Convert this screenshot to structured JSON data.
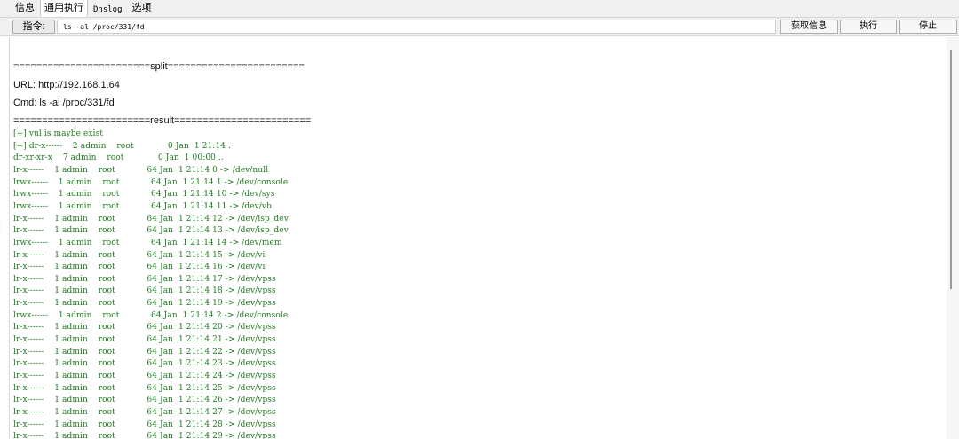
{
  "tabs": [
    {
      "label": "信息"
    },
    {
      "label": "通用执行"
    },
    {
      "label": "Dnslog"
    },
    {
      "label": "选项"
    }
  ],
  "toolbar": {
    "cmd_label": "指令:",
    "cmd_value": "ls -al /proc/331/fd",
    "btn_info": "获取信息",
    "btn_exec": "执行",
    "btn_stop": "停止"
  },
  "output": {
    "split_line": "========================split========================",
    "url": "URL: http://192.168.1.64",
    "cmd": "Cmd: ls -al /proc/331/fd",
    "result_line": "========================result========================",
    "lines": [
      "[+] vul is maybe exist",
      "[+] dr-x------    2 admin    root             0 Jan  1 21:14 .",
      "dr-xr-xr-x    7 admin    root             0 Jan  1 00:00 ..",
      "lr-x------    1 admin    root            64 Jan  1 21:14 0 -> /dev/null",
      "lrwx------    1 admin    root            64 Jan  1 21:14 1 -> /dev/console",
      "lrwx------    1 admin    root            64 Jan  1 21:14 10 -> /dev/sys",
      "lrwx------    1 admin    root            64 Jan  1 21:14 11 -> /dev/vb",
      "lr-x------    1 admin    root            64 Jan  1 21:14 12 -> /dev/isp_dev",
      "lr-x------    1 admin    root            64 Jan  1 21:14 13 -> /dev/isp_dev",
      "lrwx------    1 admin    root            64 Jan  1 21:14 14 -> /dev/mem",
      "lr-x------    1 admin    root            64 Jan  1 21:14 15 -> /dev/vi",
      "lr-x------    1 admin    root            64 Jan  1 21:14 16 -> /dev/vi",
      "lr-x------    1 admin    root            64 Jan  1 21:14 17 -> /dev/vpss",
      "lr-x------    1 admin    root            64 Jan  1 21:14 18 -> /dev/vpss",
      "lr-x------    1 admin    root            64 Jan  1 21:14 19 -> /dev/vpss",
      "lrwx------    1 admin    root            64 Jan  1 21:14 2 -> /dev/console",
      "lr-x------    1 admin    root            64 Jan  1 21:14 20 -> /dev/vpss",
      "lr-x------    1 admin    root            64 Jan  1 21:14 21 -> /dev/vpss",
      "lr-x------    1 admin    root            64 Jan  1 21:14 22 -> /dev/vpss",
      "lr-x------    1 admin    root            64 Jan  1 21:14 23 -> /dev/vpss",
      "lr-x------    1 admin    root            64 Jan  1 21:14 24 -> /dev/vpss",
      "lr-x------    1 admin    root            64 Jan  1 21:14 25 -> /dev/vpss",
      "lr-x------    1 admin    root            64 Jan  1 21:14 26 -> /dev/vpss",
      "lr-x------    1 admin    root            64 Jan  1 21:14 27 -> /dev/vpss",
      "lr-x------    1 admin    root            64 Jan  1 21:14 28 -> /dev/vpss",
      "lr-x------    1 admin    root            64 Jan  1 21:14 29 -> /dev/vpss"
    ]
  }
}
